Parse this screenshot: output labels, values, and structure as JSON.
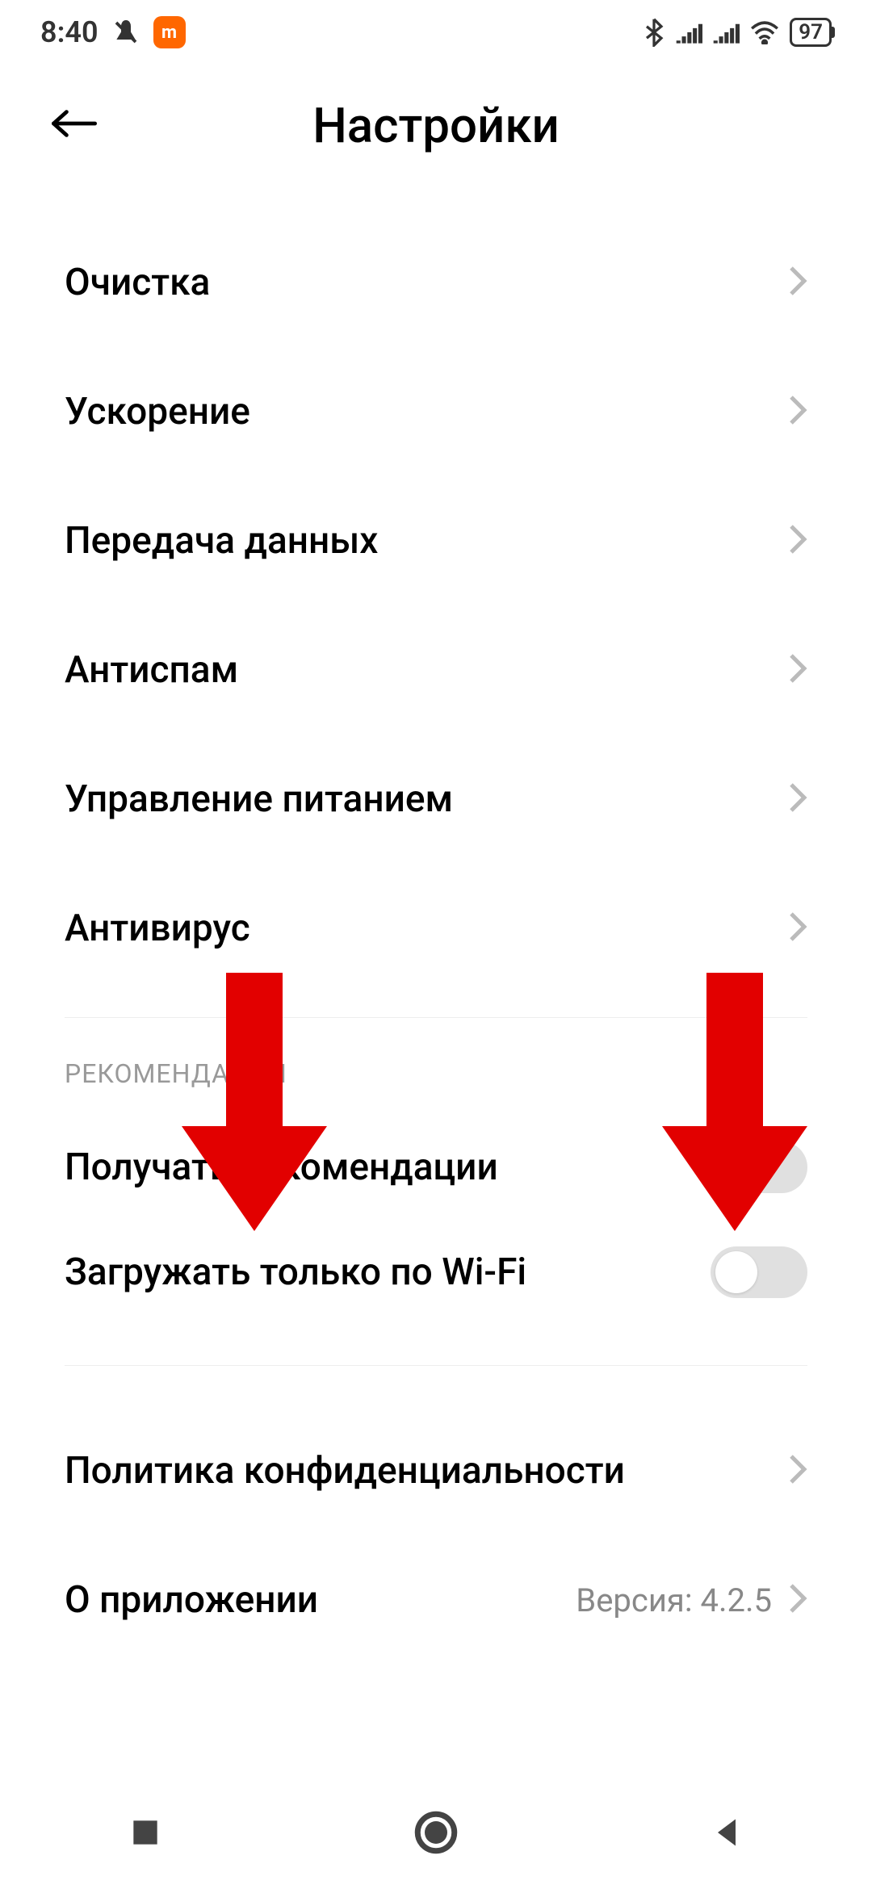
{
  "statusBar": {
    "time": "8:40",
    "batteryLevel": "97"
  },
  "header": {
    "title": "Настройки"
  },
  "items": [
    {
      "label": "Очистка"
    },
    {
      "label": "Ускорение"
    },
    {
      "label": "Передача данных"
    },
    {
      "label": "Антиспам"
    },
    {
      "label": "Управление питанием"
    },
    {
      "label": "Антивирус"
    }
  ],
  "recommendationsSection": {
    "header": "РЕКОМЕНДАЦИИ",
    "toggles": [
      {
        "label": "Получать рекомендации",
        "on": false
      },
      {
        "label": "Загружать только по Wi-Fi",
        "on": false
      }
    ]
  },
  "footerItems": [
    {
      "label": "Политика конфиденциальности",
      "value": ""
    },
    {
      "label": "О приложении",
      "value": "Версия: 4.2.5"
    }
  ],
  "annotations": {
    "arrowColor": "#E20000"
  }
}
